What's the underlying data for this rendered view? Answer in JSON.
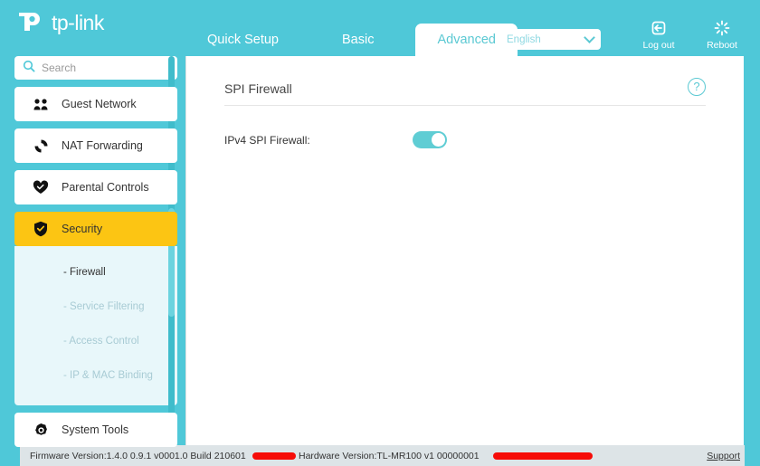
{
  "brand": {
    "name": "tp-link",
    "logo_icon": "tplink-logo-icon"
  },
  "header": {
    "tabs": [
      {
        "label": "Quick Setup",
        "active": false
      },
      {
        "label": "Basic",
        "active": false
      },
      {
        "label": "Advanced",
        "active": true
      }
    ],
    "language": {
      "value": "English",
      "chevron_icon": "chevron-down-icon"
    },
    "actions": [
      {
        "label": "Log out",
        "icon": "logout-icon"
      },
      {
        "label": "Reboot",
        "icon": "reboot-icon"
      }
    ]
  },
  "sidebar": {
    "search": {
      "placeholder": "Search",
      "value": "",
      "icon": "search-icon"
    },
    "items": [
      {
        "label": "Guest Network",
        "icon": "guest-network-icon",
        "active": false
      },
      {
        "label": "NAT Forwarding",
        "icon": "nat-forwarding-icon",
        "active": false
      },
      {
        "label": "Parental Controls",
        "icon": "parental-controls-icon",
        "active": false
      },
      {
        "label": "Security",
        "icon": "security-shield-icon",
        "active": true
      },
      {
        "label": "System Tools",
        "icon": "system-tools-gear-icon",
        "active": false
      }
    ],
    "submenu": [
      {
        "label": "- Firewall",
        "active": true
      },
      {
        "label": "- Service Filtering",
        "active": false
      },
      {
        "label": "- Access Control",
        "active": false
      },
      {
        "label": "- IP & MAC Binding",
        "active": false
      }
    ]
  },
  "main": {
    "panel_title": "SPI Firewall",
    "help_icon": "help-question-icon",
    "fields": [
      {
        "label": "IPv4 SPI Firewall:",
        "type": "toggle",
        "value": "on"
      }
    ]
  },
  "footer": {
    "firmware_version": "Firmware Version:1.4.0 0.9.1 v0001.0 Build 210601",
    "hardware_version": "Hardware Version:TL-MR100 v1 00000001",
    "support_label": "Support"
  },
  "colors": {
    "brand_teal": "#4FC8D8",
    "accent_amber": "#FCC513",
    "toggle_on": "#5FCDD4",
    "submenu_bg": "#E8F7FA",
    "footer_bg": "#DDE4E7",
    "redaction": "#F60C08"
  }
}
